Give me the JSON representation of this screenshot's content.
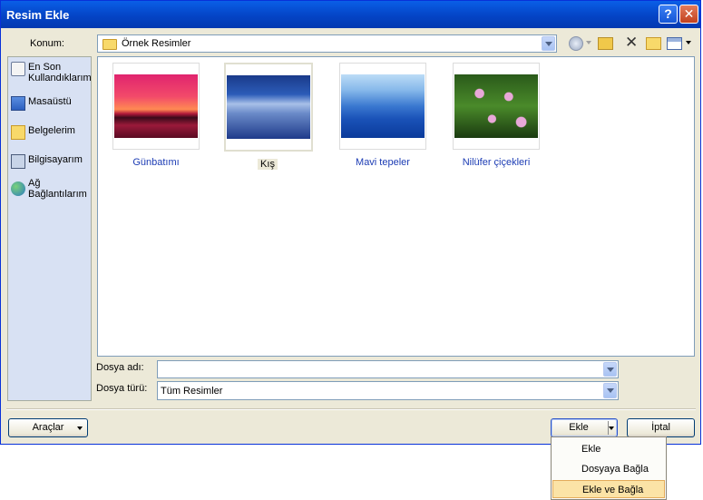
{
  "window": {
    "title": "Resim Ekle",
    "help_icon": "?",
    "close_icon": "✕"
  },
  "location": {
    "label": "Konum:",
    "value": "Örnek Resimler"
  },
  "toolbar": {
    "back": "back-arrow",
    "up": "up-folder",
    "delete": "delete",
    "new_folder": "new-folder",
    "views": "views-menu"
  },
  "places": [
    {
      "label1": "En Son",
      "label2": "Kullandıklarım"
    },
    {
      "label1": "Masaüstü",
      "label2": ""
    },
    {
      "label1": "Belgelerim",
      "label2": ""
    },
    {
      "label1": "Bilgisayarım",
      "label2": ""
    },
    {
      "label1": "Ağ",
      "label2": "Bağlantılarım"
    }
  ],
  "files": [
    {
      "name": "Günbatımı"
    },
    {
      "name": "Kış"
    },
    {
      "name": "Mavi tepeler"
    },
    {
      "name": "Nilüfer çiçekleri"
    }
  ],
  "filename": {
    "label": "Dosya adı:",
    "value": ""
  },
  "filetype": {
    "label": "Dosya türü:",
    "value": "Tüm Resimler"
  },
  "buttons": {
    "tools": "Araçlar",
    "insert": "Ekle",
    "cancel": "İptal"
  },
  "menu": {
    "items": [
      "Ekle",
      "Dosyaya Bağla",
      "Ekle ve Bağla"
    ],
    "highlighted": "Ekle ve Bağla"
  }
}
